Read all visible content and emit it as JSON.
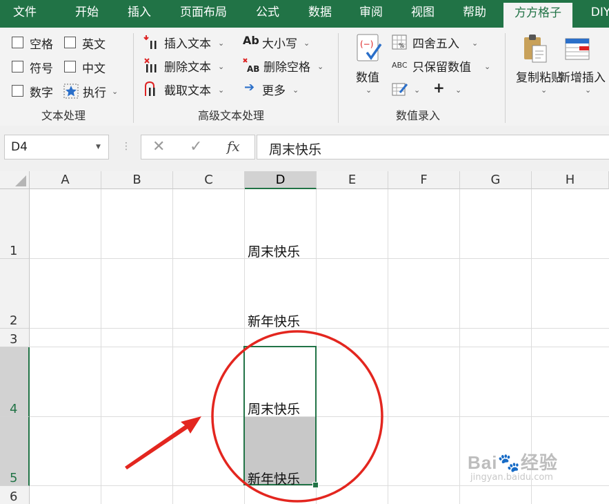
{
  "menu_tabs": [
    "文件",
    "开始",
    "插入",
    "页面布局",
    "公式",
    "数据",
    "审阅",
    "视图",
    "帮助",
    "方方格子",
    "DIY"
  ],
  "active_tab": "方方格子",
  "ribbon": {
    "text_processing": {
      "checkboxes": [
        "空格",
        "英文",
        "符号",
        "中文",
        "数字"
      ],
      "execute": "执行",
      "group_label": "文本处理"
    },
    "advanced_text": {
      "insert_text": "插入文本",
      "delete_text": "删除文本",
      "extract_text": "截取文本",
      "case": "大小写",
      "delete_space": "删除空格",
      "more": "更多",
      "group_label": "高级文本处理"
    },
    "numeric_entry": {
      "value": "数值",
      "round": "四舍五入",
      "keep_values": "只保留数值",
      "group_label": "数值录入"
    },
    "tools": {
      "copy_paste": "复制粘贴",
      "new_insert": "新增插入"
    }
  },
  "formula_bar": {
    "name_box": "D4",
    "fx": "fx",
    "content": "周末快乐"
  },
  "columns": [
    "A",
    "B",
    "C",
    "D",
    "E",
    "F",
    "G",
    "H"
  ],
  "selected_column": "D",
  "rows": [
    "1",
    "2",
    "3",
    "4",
    "5",
    "6"
  ],
  "cells": {
    "D1": "周末快乐",
    "D2": "新年快乐",
    "D4": "周末快乐",
    "D5": "新年快乐"
  },
  "colors": {
    "excel_green": "#217346",
    "annotation_red": "#e3261f",
    "selection_fill": "#c8c8c8"
  }
}
